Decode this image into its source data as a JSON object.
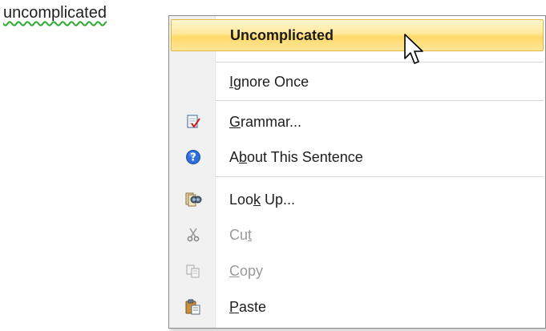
{
  "document": {
    "misspelled_word": "uncomplicated"
  },
  "context_menu": {
    "suggestion": "Uncomplicated",
    "items": [
      {
        "pre": "",
        "u": "I",
        "post": "gnore Once",
        "icon": "none",
        "enabled": true
      },
      {
        "pre": "",
        "u": "G",
        "post": "rammar...",
        "icon": "grammar-check-icon",
        "enabled": true
      },
      {
        "pre": "A",
        "u": "b",
        "post": "out This Sentence",
        "icon": "help-icon",
        "enabled": true
      },
      {
        "pre": "Loo",
        "u": "k",
        "post": " Up...",
        "icon": "research-binoculars-icon",
        "enabled": true
      },
      {
        "pre": "Cu",
        "u": "t",
        "post": "",
        "icon": "scissors-icon",
        "enabled": false
      },
      {
        "pre": "",
        "u": "C",
        "post": "opy",
        "icon": "copy-icon",
        "enabled": false
      },
      {
        "pre": "",
        "u": "P",
        "post": "aste",
        "icon": "paste-icon",
        "enabled": true
      }
    ]
  },
  "colors": {
    "highlight": "#ffd968",
    "squiggle": "#2eaa2e",
    "disabled_text": "#9a9a9a"
  }
}
